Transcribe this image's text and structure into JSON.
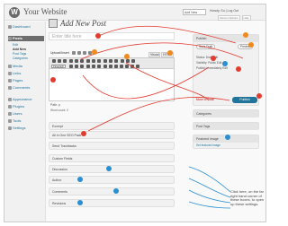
{
  "header": {
    "logo_glyph": "W",
    "site_title": "Your Website",
    "new_post_select": "Add New",
    "user_text": "Howdy, Su | Log Out",
    "screen_options": "Screen Options",
    "help": "Help"
  },
  "sidebar": {
    "items": [
      {
        "label": "Dashboard"
      },
      {
        "label": "Posts"
      },
      {
        "label": "Media"
      },
      {
        "label": "Links"
      },
      {
        "label": "Pages"
      },
      {
        "label": "Comments"
      },
      {
        "label": "Appearance"
      },
      {
        "label": "Plugins"
      },
      {
        "label": "Users"
      },
      {
        "label": "Tools"
      },
      {
        "label": "Settings"
      }
    ],
    "sub_items": [
      "Edit",
      "Add New",
      "Post Tags",
      "Categories"
    ]
  },
  "main": {
    "page_title": "Add New Post",
    "title_placeholder": "Enter title here",
    "upload_insert": "Upload/Insert",
    "tab_visual": "Visual",
    "tab_html": "HTML",
    "format_select": "Paragraph",
    "path_label": "Path: p",
    "word_count": "Word count: 0",
    "boxes": [
      {
        "label": "Excerpt"
      },
      {
        "label": "All in One SEO Pack"
      },
      {
        "label": "Send Trackbacks"
      },
      {
        "label": "Custom Fields"
      },
      {
        "label": "Discussion"
      },
      {
        "label": "Author"
      },
      {
        "label": "Comments"
      },
      {
        "label": "Revisions"
      }
    ]
  },
  "publish": {
    "title": "Publish",
    "save_draft": "Save Draft",
    "preview": "Preview",
    "status": "Status: Draft Edit",
    "visibility": "Visibility: Public Edit",
    "publish_immediately": "Publish immediately Edit",
    "move_to_trash": "Move to Trash",
    "publish_button": "Publish"
  },
  "right_boxes": {
    "categories": "Categories",
    "post_tags": "Post Tags",
    "featured_image": "Featured Image",
    "set_featured_image": "Set featured image"
  },
  "callout_text": "Click here, on the far right hand corner of these boxes, to open up these settings.",
  "colors": {
    "marker_red": "#e23b2f",
    "marker_orange": "#f08a1c",
    "marker_blue": "#2a8fd0",
    "wp_blue": "#21759b"
  }
}
